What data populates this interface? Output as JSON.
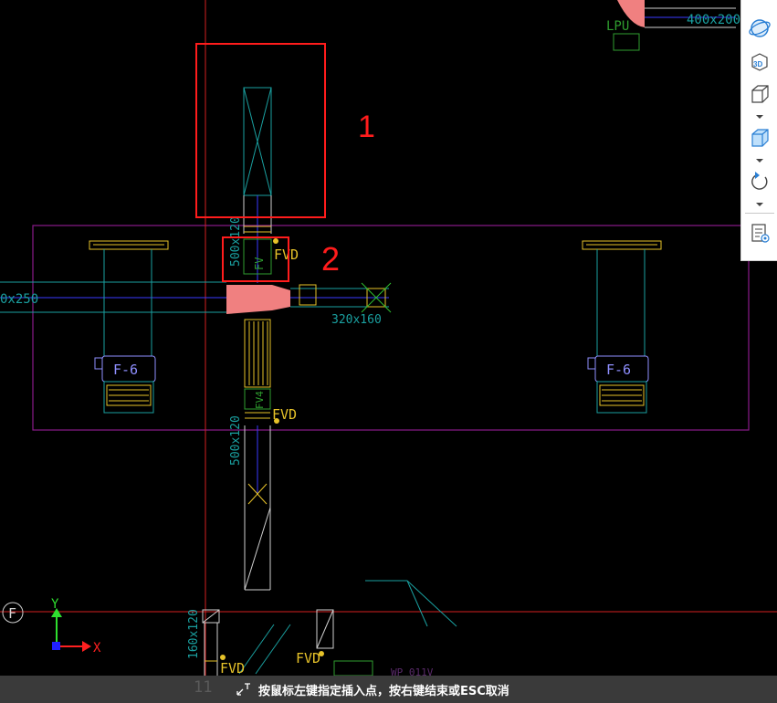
{
  "cad": {
    "labels": {
      "duct_top_right": "400x200",
      "lpu": "LPU",
      "duct_left": "0x250",
      "duct_upper": "500x120",
      "duct_lower": "500x120",
      "duct_small": "320x160",
      "duct_bottom_left": "160x120",
      "fvd_1": "FVD",
      "fvd_2": "FVD",
      "fvd_3": "FVD",
      "fvd_4": "FVD",
      "unit_left": "F-6",
      "unit_right": "F-6",
      "fv_upper": "FV",
      "fv_lower": "FV4",
      "grid_label": "F",
      "axis_y": "Y",
      "axis_x": "X",
      "bottom_faint": "WP 011V"
    },
    "annotations": {
      "box_1_number": "1",
      "box_2_number": "2"
    }
  },
  "toolbar": {
    "items": [
      {
        "icon": "orbit-icon"
      },
      {
        "icon": "3d-view-icon",
        "text": "3D"
      },
      {
        "icon": "wireframe-cube-icon"
      },
      {
        "icon": "shaded-cube-icon"
      },
      {
        "icon": "rotate-icon"
      },
      {
        "icon": "properties-icon"
      }
    ]
  },
  "status_bar": {
    "layer_number": "11",
    "prompt": "按鼠标左键指定插入点，按右键结束或ESC取消"
  },
  "colors": {
    "background": "#000000",
    "crosshair": "#d42020",
    "duct_line": "#cfcfcf",
    "cyan_line": "#1aa0a0",
    "text_yellow": "#e6c229",
    "unit_blue": "#8f8fff",
    "magenta_border": "#8a1c8a",
    "pink_fill": "#f08080",
    "annotation_red": "#ff1c1c",
    "green_label": "#2f9e2f"
  }
}
